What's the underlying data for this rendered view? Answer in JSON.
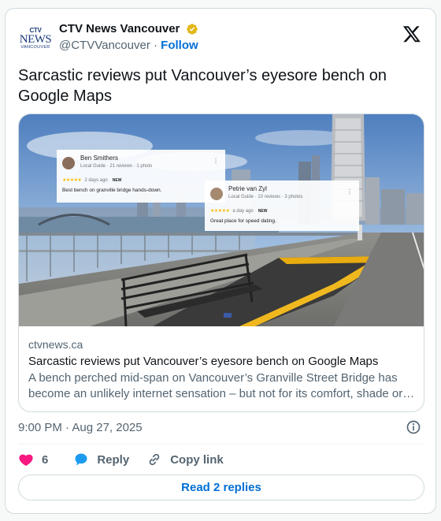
{
  "author": {
    "logo_top": "CTV",
    "logo_main": "NEWS",
    "logo_city": "VANCOUVER",
    "display_name": "CTV News Vancouver",
    "handle": "@CTVVancouver",
    "separator": "·",
    "follow_label": "Follow"
  },
  "tweet": {
    "text": "Sarcastic reviews put Vancouver’s eyesore bench on Google Maps",
    "timestamp": "9:00 PM · Aug 27, 2025"
  },
  "link_card": {
    "domain": "ctvnews.ca",
    "title": "Sarcastic reviews put Vancouver’s eyesore bench on Google Maps",
    "description": "A bench perched mid-span on Vancouver’s Granville Street Bridge has become an unlikely internet sensation – but not for its comfort, shade or view. It has instead become a target of sarcastic online reviews.",
    "reviews": [
      {
        "name": "Ben Smithers",
        "meta": "Local Guide · 21 reviews · 1 photo",
        "stars": "★★★★★",
        "when": "2 days ago",
        "badge": "NEW",
        "text": "Best bench on granville bridge hands-down."
      },
      {
        "name": "Petrie van Zyl",
        "meta": "Local Guide · 10 reviews · 3 photos",
        "stars": "★★★★★",
        "when": "a day ago",
        "badge": "NEW",
        "text": "Great place for speed dating."
      }
    ]
  },
  "actions": {
    "like_count": "6",
    "reply_label": "Reply",
    "copy_link_label": "Copy link"
  },
  "read_replies_label": "Read 2 replies",
  "colors": {
    "accent": "#006fd6",
    "like": "#f91880",
    "verified": "#e2b719",
    "reply_icon": "#1d9bf0"
  }
}
